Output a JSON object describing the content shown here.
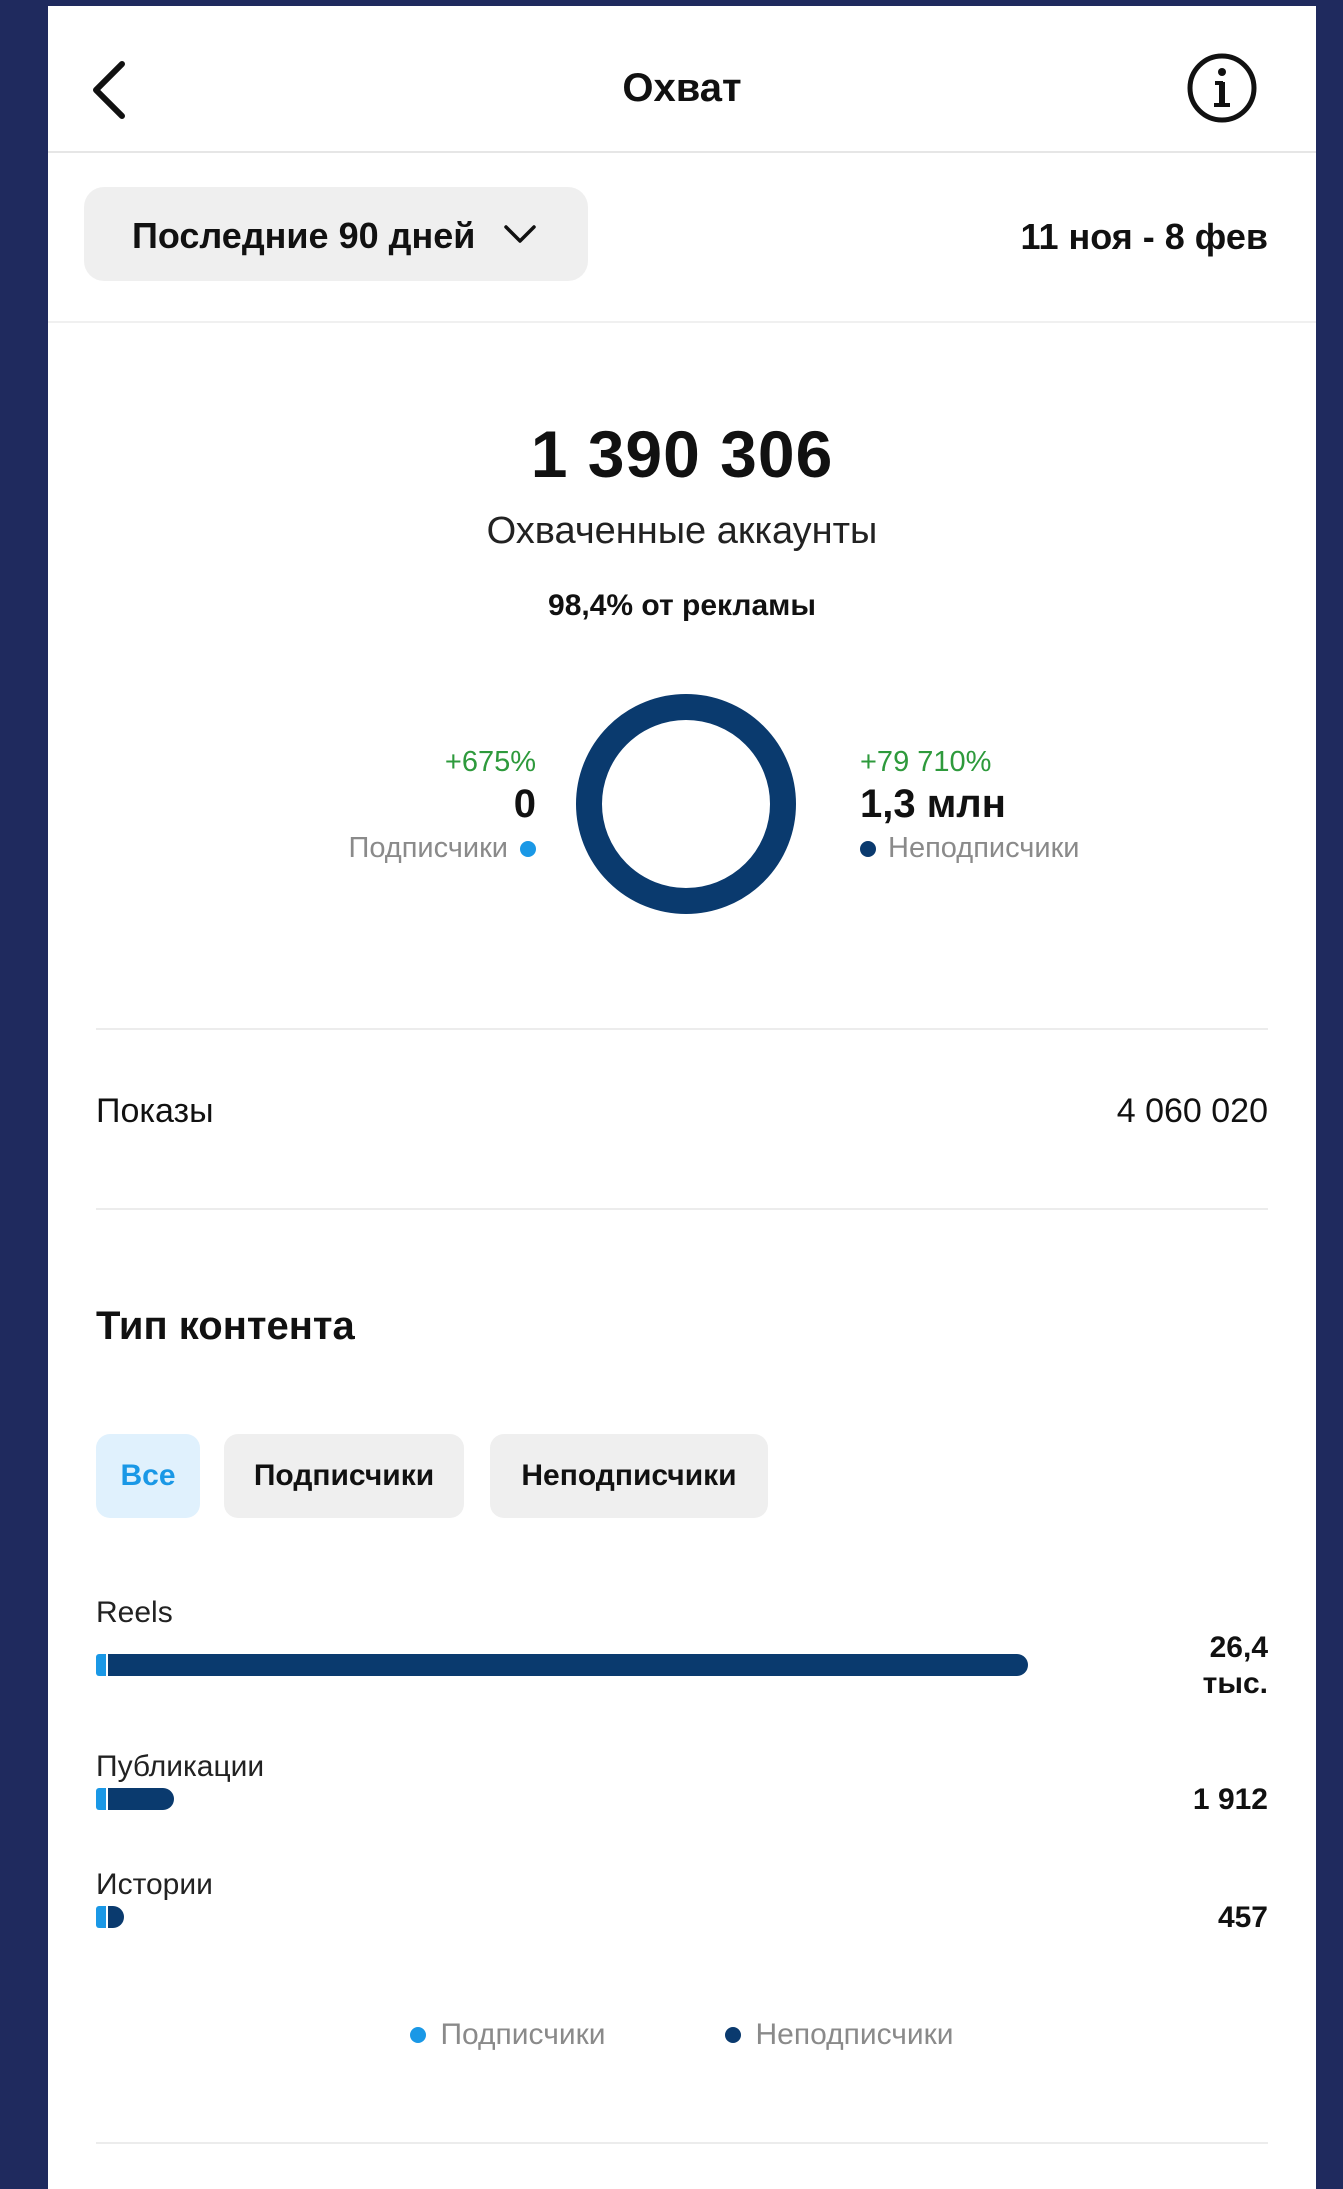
{
  "header": {
    "title": "Охват",
    "back_icon": "back-arrow-icon",
    "info_icon": "info-icon"
  },
  "filter": {
    "range_label": "Последние 90 дней",
    "date_range": "11 ноя - 8 фев"
  },
  "summary": {
    "total": "1 390 306",
    "total_label": "Охваченные аккаунты",
    "ads_share": "98,4% от рекламы"
  },
  "breakdown": {
    "followers": {
      "change": "+675%",
      "value": "0",
      "label": "Подписчики",
      "color": "#1a98e6"
    },
    "non_followers": {
      "change": "+79 710%",
      "value": "1,3 млн",
      "label": "Неподписчики",
      "color": "#0a3a6e"
    }
  },
  "impressions": {
    "label": "Показы",
    "value": "4 060 020"
  },
  "content_type": {
    "title": "Тип контента",
    "tabs": [
      {
        "label": "Все",
        "active": true
      },
      {
        "label": "Подписчики",
        "active": false
      },
      {
        "label": "Неподписчики",
        "active": false
      }
    ],
    "rows": [
      {
        "label": "Reels",
        "value_line1": "26,4",
        "value_line2": "тыс.",
        "share": 1.0
      },
      {
        "label": "Публикации",
        "value_line1": "1 912",
        "value_line2": "",
        "share": 0.072
      },
      {
        "label": "Истории",
        "value_line1": "457",
        "value_line2": "",
        "share": 0.017
      }
    ]
  },
  "legend": {
    "followers": "Подписчики",
    "non_followers": "Неподписчики"
  }
}
